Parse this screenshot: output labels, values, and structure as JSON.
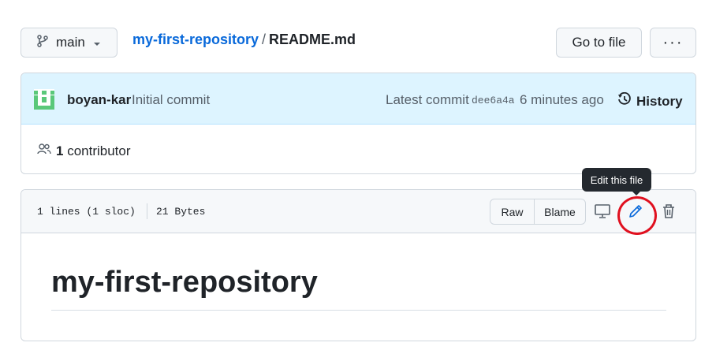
{
  "header": {
    "branch_label": "main",
    "repo_name": "my-first-repository",
    "separator": "/",
    "file_name": "README.md",
    "goto_file_label": "Go to file",
    "more_label": "···"
  },
  "commit": {
    "author": "boyan-kar",
    "message": "Initial commit",
    "latest_label": "Latest commit",
    "sha": "dee6a4a",
    "time_ago": "6 minutes ago",
    "history_label": "History",
    "contributor_count": "1",
    "contributor_label": "contributor"
  },
  "file": {
    "lines_info": "1 lines (1 sloc)",
    "size_info": "21 Bytes",
    "raw_label": "Raw",
    "blame_label": "Blame",
    "tooltip": "Edit this file"
  },
  "readme": {
    "title": "my-first-repository"
  },
  "colors": {
    "link": "#0969da",
    "commit_bg": "#ddf4ff",
    "edit_icon": "#0969da",
    "highlight_circle": "#e0101f",
    "avatar": "#5ac87a"
  },
  "icons": [
    "git-branch-icon",
    "caret-down-icon",
    "kebab-icon",
    "history-icon",
    "people-icon",
    "monitor-icon",
    "pencil-icon",
    "trash-icon"
  ]
}
